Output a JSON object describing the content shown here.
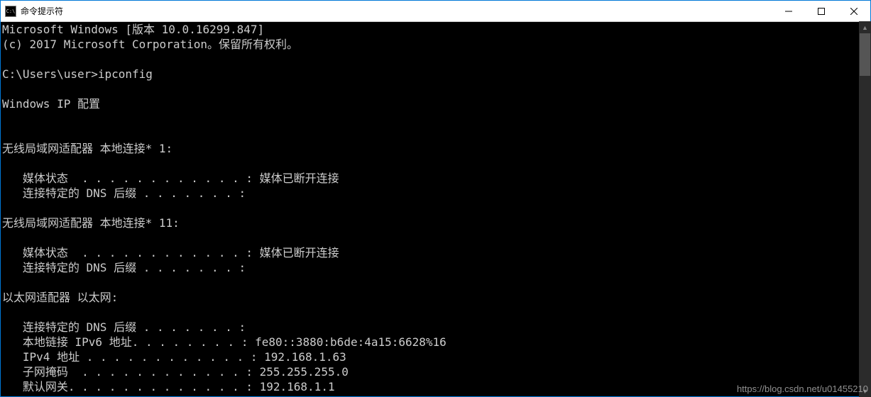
{
  "titlebar": {
    "icon_label": "C:\\",
    "title": "命令提示符"
  },
  "terminal": {
    "lines": [
      "Microsoft Windows [版本 10.0.16299.847]",
      "(c) 2017 Microsoft Corporation。保留所有权利。",
      "",
      "C:\\Users\\user>ipconfig",
      "",
      "Windows IP 配置",
      "",
      "",
      "无线局域网适配器 本地连接* 1:",
      "",
      "   媒体状态  . . . . . . . . . . . . : 媒体已断开连接",
      "   连接特定的 DNS 后缀 . . . . . . . :",
      "",
      "无线局域网适配器 本地连接* 11:",
      "",
      "   媒体状态  . . . . . . . . . . . . : 媒体已断开连接",
      "   连接特定的 DNS 后缀 . . . . . . . :",
      "",
      "以太网适配器 以太网:",
      "",
      "   连接特定的 DNS 后缀 . . . . . . . :",
      "   本地链接 IPv6 地址. . . . . . . . : fe80::3880:b6de:4a15:6628%16",
      "   IPv4 地址 . . . . . . . . . . . . : 192.168.1.63",
      "   子网掩码  . . . . . . . . . . . . : 255.255.255.0",
      "   默认网关. . . . . . . . . . . . . : 192.168.1.1"
    ]
  },
  "watermark": "https://blog.csdn.net/u01455210"
}
